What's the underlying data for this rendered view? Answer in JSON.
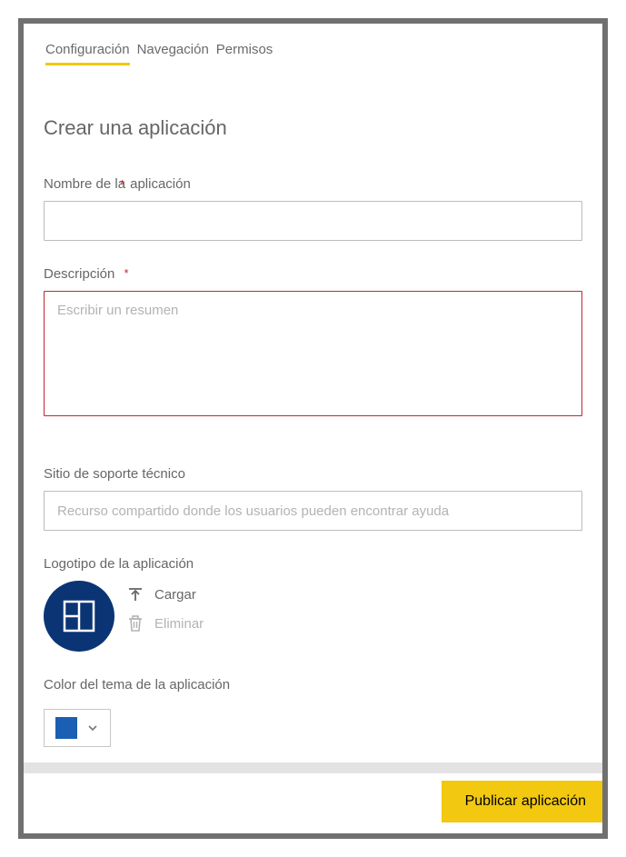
{
  "tabs": {
    "config": "Configuración",
    "nav": "Navegación",
    "perms": "Permisos"
  },
  "title": "Crear una aplicación",
  "appName": {
    "label_before": "Nombre de la",
    "label_after": "aplicación",
    "value": ""
  },
  "description": {
    "label": "Descripción",
    "placeholder": "Escribir un resumen",
    "value": ""
  },
  "supportSite": {
    "label": "Sitio de soporte técnico",
    "placeholder": "Recurso compartido donde los usuarios pueden encontrar ayuda",
    "value": ""
  },
  "logo": {
    "label": "Logotipo de la aplicación",
    "upload": "Cargar",
    "delete": "Eliminar"
  },
  "themeColor": {
    "label": "Color del tema de la aplicación",
    "color": "#1a5fb4"
  },
  "publish": "Publicar aplicación"
}
